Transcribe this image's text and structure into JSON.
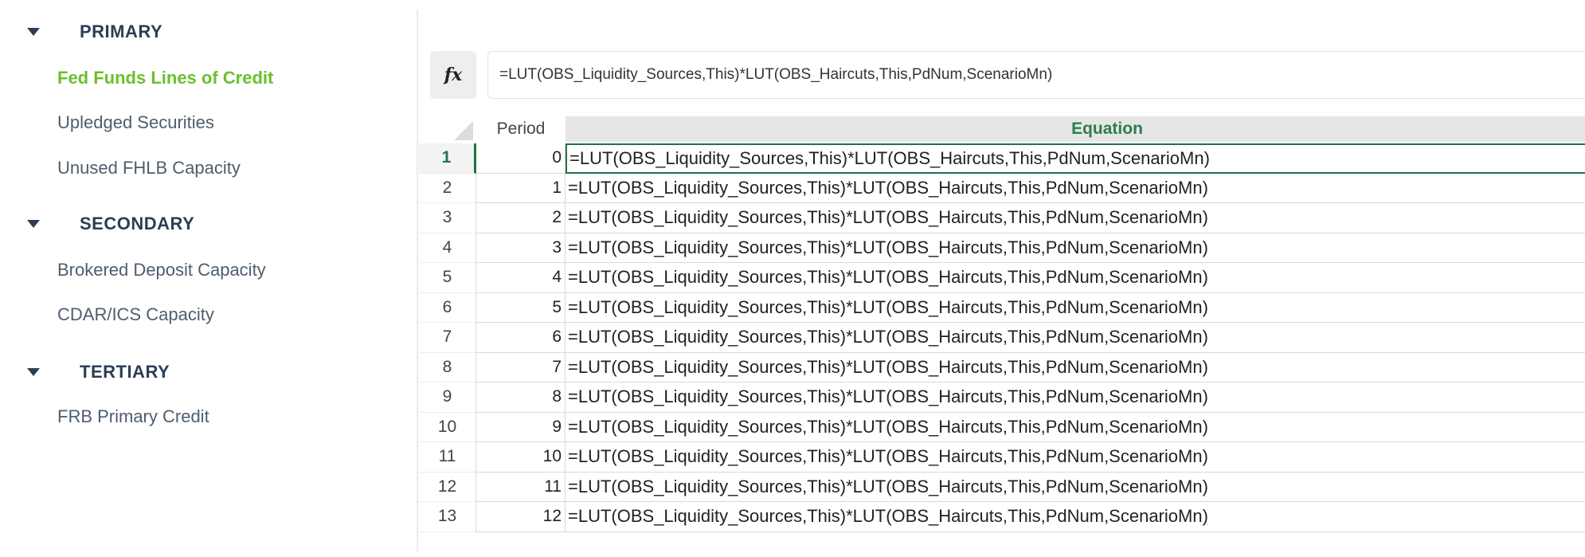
{
  "sidebar": {
    "groups": [
      {
        "label": "PRIMARY",
        "items": [
          "Fed Funds Lines of Credit",
          "Upledged Securities",
          "Unused FHLB Capacity"
        ]
      },
      {
        "label": "SECONDARY",
        "items": [
          "Brokered Deposit Capacity",
          "CDAR/ICS Capacity"
        ]
      },
      {
        "label": "TERTIARY",
        "items": [
          "FRB Primary Credit"
        ]
      }
    ],
    "active_item": "Fed Funds Lines of Credit"
  },
  "formula_bar": {
    "fx_label": "fx",
    "value": "=LUT(OBS_Liquidity_Sources,This)*LUT(OBS_Haircuts,This,PdNum,ScenarioMn)"
  },
  "grid": {
    "headers": {
      "period": "Period",
      "equation": "Equation"
    },
    "active_row": 1,
    "rows": [
      {
        "num": "1",
        "period": "0",
        "equation": "=LUT(OBS_Liquidity_Sources,This)*LUT(OBS_Haircuts,This,PdNum,ScenarioMn)"
      },
      {
        "num": "2",
        "period": "1",
        "equation": "=LUT(OBS_Liquidity_Sources,This)*LUT(OBS_Haircuts,This,PdNum,ScenarioMn)"
      },
      {
        "num": "3",
        "period": "2",
        "equation": "=LUT(OBS_Liquidity_Sources,This)*LUT(OBS_Haircuts,This,PdNum,ScenarioMn)"
      },
      {
        "num": "4",
        "period": "3",
        "equation": "=LUT(OBS_Liquidity_Sources,This)*LUT(OBS_Haircuts,This,PdNum,ScenarioMn)"
      },
      {
        "num": "5",
        "period": "4",
        "equation": "=LUT(OBS_Liquidity_Sources,This)*LUT(OBS_Haircuts,This,PdNum,ScenarioMn)"
      },
      {
        "num": "6",
        "period": "5",
        "equation": "=LUT(OBS_Liquidity_Sources,This)*LUT(OBS_Haircuts,This,PdNum,ScenarioMn)"
      },
      {
        "num": "7",
        "period": "6",
        "equation": "=LUT(OBS_Liquidity_Sources,This)*LUT(OBS_Haircuts,This,PdNum,ScenarioMn)"
      },
      {
        "num": "8",
        "period": "7",
        "equation": "=LUT(OBS_Liquidity_Sources,This)*LUT(OBS_Haircuts,This,PdNum,ScenarioMn)"
      },
      {
        "num": "9",
        "period": "8",
        "equation": "=LUT(OBS_Liquidity_Sources,This)*LUT(OBS_Haircuts,This,PdNum,ScenarioMn)"
      },
      {
        "num": "10",
        "period": "9",
        "equation": "=LUT(OBS_Liquidity_Sources,This)*LUT(OBS_Haircuts,This,PdNum,ScenarioMn)"
      },
      {
        "num": "11",
        "period": "10",
        "equation": "=LUT(OBS_Liquidity_Sources,This)*LUT(OBS_Haircuts,This,PdNum,ScenarioMn)"
      },
      {
        "num": "12",
        "period": "11",
        "equation": "=LUT(OBS_Liquidity_Sources,This)*LUT(OBS_Haircuts,This,PdNum,ScenarioMn)"
      },
      {
        "num": "13",
        "period": "12",
        "equation": "=LUT(OBS_Liquidity_Sources,This)*LUT(OBS_Haircuts,This,PdNum,ScenarioMn)"
      }
    ]
  },
  "colors": {
    "active_nav": "#6cbf2c",
    "equation_header": "#2e7d4a",
    "selection": "#217346"
  },
  "icons": {
    "group_toggle": "caret-down-icon",
    "formula": "fx-icon"
  }
}
